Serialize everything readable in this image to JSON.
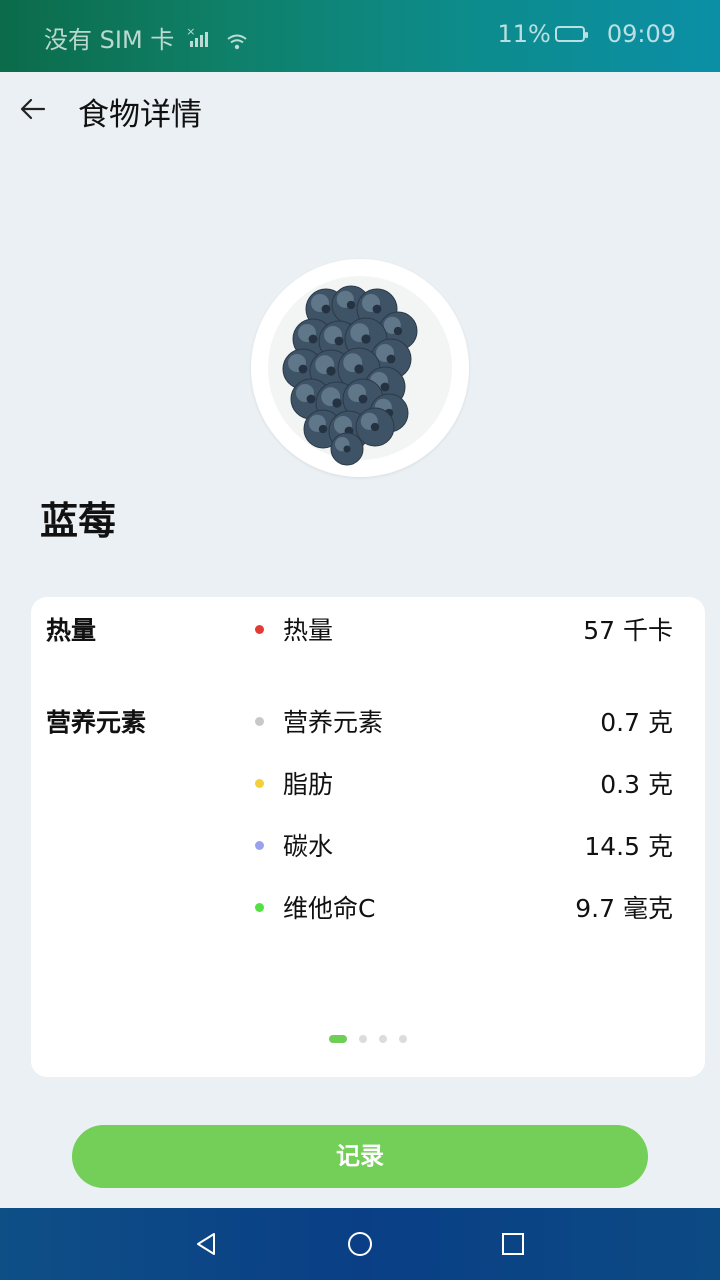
{
  "status_bar": {
    "carrier": "没有 SIM 卡",
    "battery": "11%",
    "battery_level": 0.11,
    "time": "09:09"
  },
  "header": {
    "title": "食物详情",
    "back_icon": "arrow-left-icon"
  },
  "food": {
    "name": "蓝莓",
    "image": "blueberries-bowl"
  },
  "nutrition": {
    "calories_section": {
      "label": "热量",
      "items": [
        {
          "name": "热量",
          "value": "57 千卡",
          "color": "#e53935"
        }
      ]
    },
    "nutrients_section": {
      "label": "营养元素",
      "items": [
        {
          "name": "营养元素",
          "value": "0.7 克",
          "color": "#c8c8c8"
        },
        {
          "name": "脂肪",
          "value": "0.3 克",
          "color": "#f2d03b"
        },
        {
          "name": "碳水",
          "value": "14.5 克",
          "color": "#9aa2ef"
        },
        {
          "name": "维他命C",
          "value": "9.7 毫克",
          "color": "#53e042"
        }
      ]
    },
    "pager": {
      "count": 4,
      "active": 0
    }
  },
  "record_button": {
    "label": "记录",
    "color": "#73cf57"
  },
  "nav_bar": {
    "back": "triangle-back-icon",
    "home": "circle-home-icon",
    "recents": "square-recents-icon"
  }
}
